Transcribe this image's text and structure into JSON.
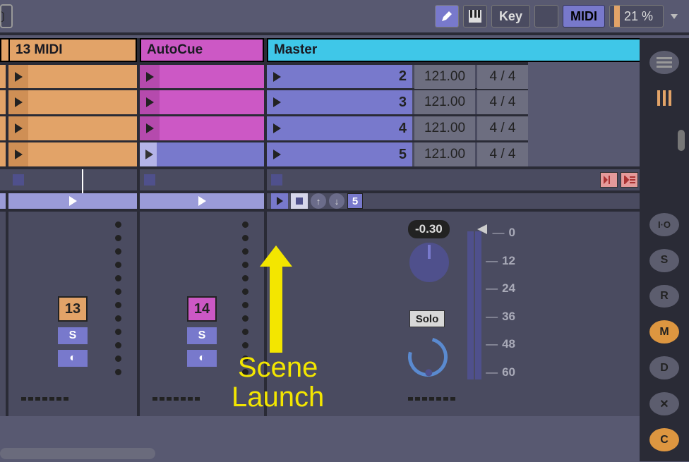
{
  "topbar": {
    "pencil_icon": "pencil",
    "piano_icon": "piano",
    "key_label": "Key",
    "midi_label": "MIDI",
    "pct_label": "21 %"
  },
  "tracks": {
    "midi": {
      "name": "13 MIDI",
      "number": "13",
      "s_label": "S"
    },
    "auto": {
      "name": "AutoCue",
      "number": "14",
      "s_label": "S"
    },
    "master": {
      "name": "Master"
    }
  },
  "scenes": [
    {
      "num": "2",
      "tempo": "121.00",
      "sig": "4 / 4"
    },
    {
      "num": "3",
      "tempo": "121.00",
      "sig": "4 / 4"
    },
    {
      "num": "4",
      "tempo": "121.00",
      "sig": "4 / 4"
    },
    {
      "num": "5",
      "tempo": "121.00",
      "sig": "4 / 4"
    }
  ],
  "master_ctrl": {
    "launch_num": "5"
  },
  "master_mixer": {
    "db": "-0.30",
    "solo": "Solo",
    "scale": [
      "0",
      "12",
      "24",
      "36",
      "48",
      "60"
    ]
  },
  "side": {
    "io": "I·O",
    "s": "S",
    "r": "R",
    "m": "M",
    "d": "D",
    "x": "✕",
    "c": "C"
  },
  "annotation": {
    "line1": "Scene",
    "line2": "Launch"
  }
}
